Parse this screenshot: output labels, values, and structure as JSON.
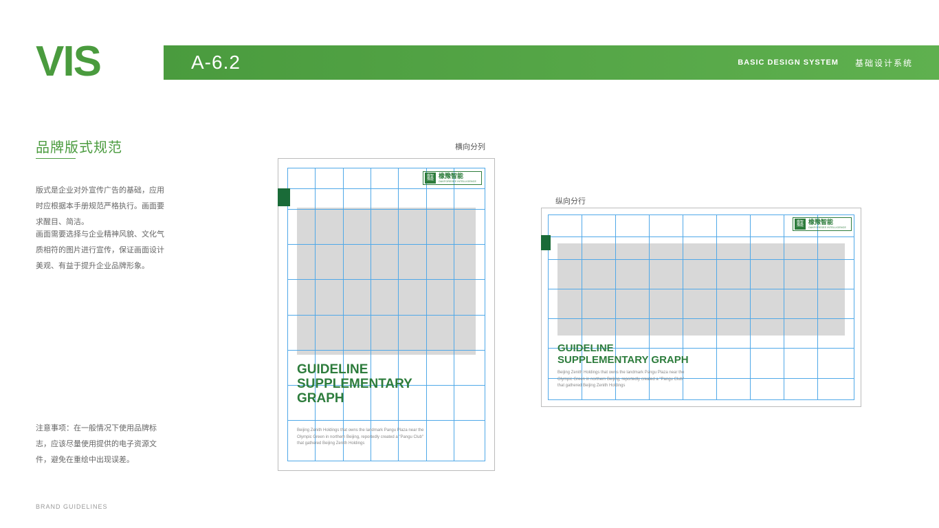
{
  "vis": "VIS",
  "header": {
    "code": "A-6.2",
    "en": "BASIC DESIGN SYSTEM",
    "cn": "基础设计系统"
  },
  "section_title": "品牌版式规范",
  "body1": "版式是企业对外宣传广告的基础，应用时应根据本手册规范严格执行。画面要求醒目、简洁。",
  "body2": "画面需要选择与企业精神风貌、文化气质相符的图片进行宣传，保证画面设计美观、有益于提升企业品牌形象。",
  "note": "注意事项：在一般情况下使用品牌标志，应该尽量使用提供的电子资源文件，避免在重绘中出现误差。",
  "footer": "BRAND GUIDELINES",
  "label_horiz": "横向分列",
  "label_vert": "纵向分行",
  "mock": {
    "headline_l1": "GUIDELINE",
    "headline_l2": "SUPPLEMENTARY",
    "headline_l3": "GRAPH",
    "headline_land": "GUIDELINE\nSUPPLEMENTARY GRAPH",
    "sub1": "Beijing Zenith Holdings that owns the landmark Pangu Plaza near the",
    "sub2": "Olympic Green in northern Beijing, reportedly created a \"Pangu Club\"",
    "sub3": "that gathered Beijing Zenith Holdings",
    "logo_cn": "橡豫智能",
    "logo_en": "OAKFORESEE INTELLIGENCE"
  },
  "colors": {
    "brand": "#4a9b3e",
    "dark_green": "#1a6b38"
  }
}
